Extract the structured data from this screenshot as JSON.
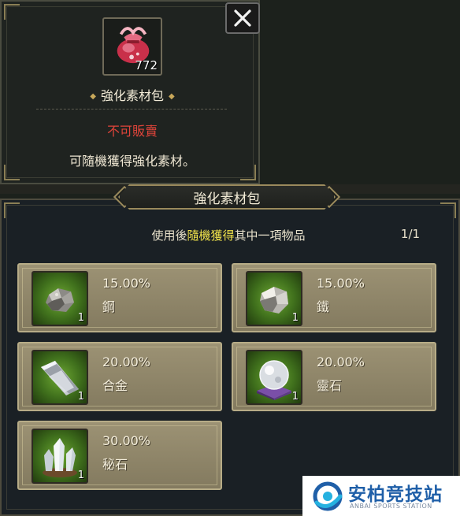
{
  "tooltip": {
    "item_name": "強化素材包",
    "count": "772",
    "status": "不可販賣",
    "description": "可隨機獲得強化素材。"
  },
  "pack": {
    "title": "強化素材包",
    "instruction_prefix": "使用後",
    "instruction_highlight": "隨機獲得",
    "instruction_suffix": "其中一項物品",
    "page": "1/1",
    "rewards": [
      {
        "percent": "15.00%",
        "name": "鋼",
        "qty": "1",
        "icon": "steel-ore-icon"
      },
      {
        "percent": "15.00%",
        "name": "鐵",
        "qty": "1",
        "icon": "iron-ore-icon"
      },
      {
        "percent": "20.00%",
        "name": "合金",
        "qty": "1",
        "icon": "alloy-ingot-icon"
      },
      {
        "percent": "20.00%",
        "name": "靈石",
        "qty": "1",
        "icon": "spirit-orb-icon"
      },
      {
        "percent": "30.00%",
        "name": "秘石",
        "qty": "1",
        "icon": "crystal-cluster-icon"
      }
    ]
  },
  "watermark": {
    "name_cn": "安柏竞技站",
    "name_en": "ANBAI SPORTS STATION"
  },
  "colors": {
    "unsellable_red": "#e0443a",
    "highlight_yellow": "#f1e34b",
    "card_bg": "#9c9274",
    "slot_green": "#6ea833"
  }
}
